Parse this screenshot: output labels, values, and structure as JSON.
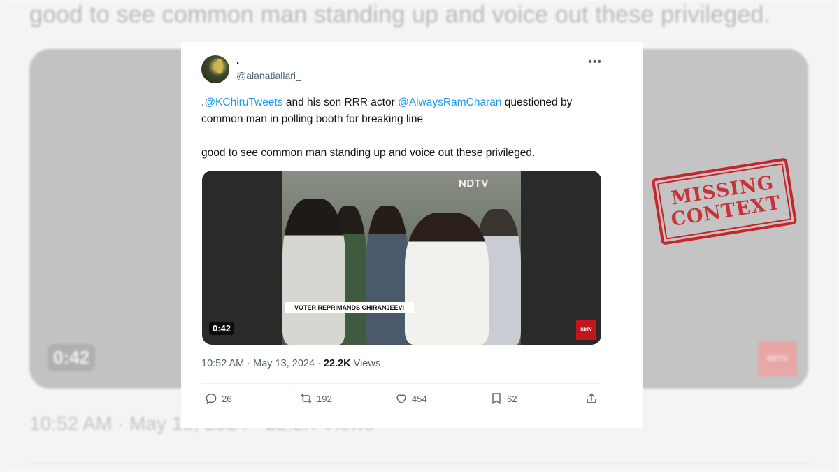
{
  "background": {
    "text": "good to see common man standing up and voice out these privileged.",
    "duration": "0:42",
    "ndtv": "NDTV",
    "meta": "10:52 AM · May 13, 2024 · 22.2K Views"
  },
  "tweet": {
    "display_name": ".",
    "handle": "@alanatiallari_",
    "more_icon": "more-horizontal-icon",
    "text_parts": [
      ".",
      "@KChiruTweets",
      " and his son RRR actor ",
      "@AlwaysRamCharan",
      " questioned by common man in polling booth for breaking line"
    ],
    "text_line2": "good to see common man standing up and voice out these privileged.",
    "media": {
      "duration": "0:42",
      "caption": "VOTER REPRIMANDS CHIRANJEEVI",
      "watermark": "NDTV",
      "logo": "NDTV"
    },
    "time": "10:52 AM",
    "date": "May 13, 2024",
    "views_count": "22.2K",
    "views_label": "Views",
    "actions": {
      "replies": "26",
      "reposts": "192",
      "likes": "454",
      "bookmarks": "62"
    }
  },
  "stamp": {
    "line1": "MISSING",
    "line2": "CONTEXT",
    "color": "#c8242a"
  },
  "colors": {
    "link": "#1d9bf0",
    "secondary_text": "#536471",
    "primary_text": "#0f1419"
  }
}
